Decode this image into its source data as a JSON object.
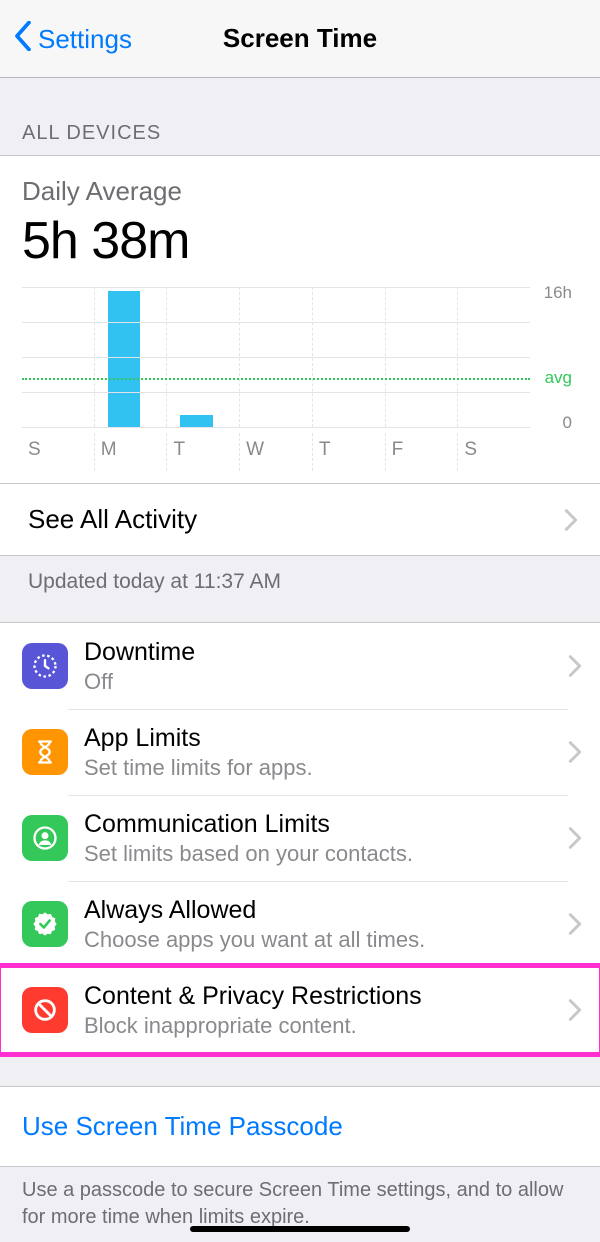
{
  "nav": {
    "back": "Settings",
    "title": "Screen Time"
  },
  "section_header": "ALL DEVICES",
  "daily_average": {
    "label": "Daily Average",
    "value": "5h 38m"
  },
  "chart_data": {
    "type": "bar",
    "categories": [
      "S",
      "M",
      "T",
      "W",
      "T",
      "F",
      "S"
    ],
    "values": [
      0,
      15.5,
      1.4,
      0,
      0,
      0,
      0
    ],
    "avg": 5.63,
    "ylim": [
      0,
      16
    ],
    "ymax_label": "16h",
    "yzero_label": "0",
    "avg_label": "avg",
    "xlabel": "",
    "ylabel": "",
    "title": ""
  },
  "see_all": "See All Activity",
  "updated": "Updated today at 11:37 AM",
  "rows": [
    {
      "title": "Downtime",
      "sub": "Off"
    },
    {
      "title": "App Limits",
      "sub": "Set time limits for apps."
    },
    {
      "title": "Communication Limits",
      "sub": "Set limits based on your contacts."
    },
    {
      "title": "Always Allowed",
      "sub": "Choose apps you want at all times."
    },
    {
      "title": "Content & Privacy Restrictions",
      "sub": "Block inappropriate content."
    }
  ],
  "passcode": "Use Screen Time Passcode",
  "footnote": "Use a passcode to secure Screen Time settings, and to allow for more time when limits expire."
}
